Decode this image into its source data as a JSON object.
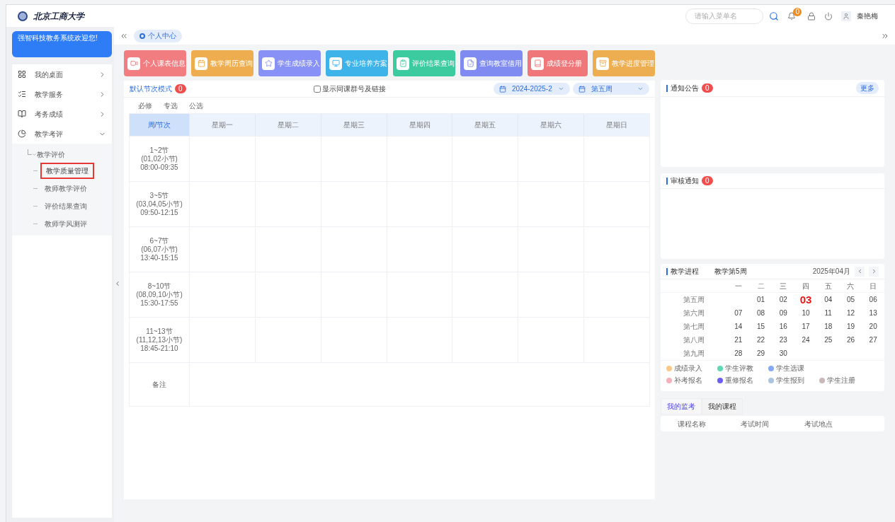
{
  "header": {
    "logo_text": "北京工商大学",
    "search": {
      "placeholder": "请输入菜单名"
    },
    "notification_count": "0",
    "user_name": "秦艳梅"
  },
  "sidebar": {
    "welcome": "强智科技教务系统欢迎您!",
    "items": [
      {
        "label": "我的桌面",
        "expanded": false,
        "kind": "desktop"
      },
      {
        "label": "教学服务",
        "expanded": false,
        "kind": "service"
      },
      {
        "label": "考务成绩",
        "expanded": false,
        "kind": "exam"
      },
      {
        "label": "教学考评",
        "expanded": true,
        "kind": "eval",
        "children": [
          {
            "label": "教学评价",
            "expanded": true,
            "children": [
              {
                "label": "教学质量管理",
                "selected": true
              },
              {
                "label": "教师教学评价",
                "selected": false
              },
              {
                "label": "评价结果查询",
                "selected": false
              },
              {
                "label": "教师学风测评",
                "selected": false
              }
            ]
          }
        ]
      }
    ]
  },
  "tabs": [
    {
      "label": "个人中心",
      "selected": true
    }
  ],
  "quick_links": [
    {
      "label": "个人课表信息",
      "color": "#f17d80",
      "kind": "video"
    },
    {
      "label": "教学周历查询",
      "color": "#eeae4f",
      "kind": "calendar"
    },
    {
      "label": "学生成绩录入",
      "color": "#8892f6",
      "kind": "star"
    },
    {
      "label": "专业培养方案",
      "color": "#3db3ea",
      "kind": "monitor"
    },
    {
      "label": "评价结果查询",
      "color": "#3ccb9f",
      "kind": "clipboard"
    },
    {
      "label": "查询教室借用",
      "color": "#7f8bf1",
      "kind": "file"
    },
    {
      "label": "成绩登分册",
      "color": "#f07779",
      "kind": "book"
    },
    {
      "label": "教学进度管理",
      "color": "#edae52",
      "kind": "archive"
    }
  ],
  "schedule": {
    "mode_label": "默认节次模式",
    "mode_badge": "0",
    "checkbox": {
      "label": "显示同课群号及链接",
      "checked": false
    },
    "term_select": "2024-2025-2",
    "week_select": "第五周",
    "legend": [
      "必修",
      "专选",
      "公选"
    ],
    "columns": [
      "周/节次",
      "星期一",
      "星期二",
      "星期三",
      "星期四",
      "星期五",
      "星期六",
      "星期日"
    ],
    "rows": [
      [
        "1~2节",
        "(01,02小节)",
        "08:00-09:35"
      ],
      [
        "3~5节",
        "(03,04,05小节)",
        "09:50-12:15"
      ],
      [
        "6~7节",
        "(06,07小节)",
        "13:40-15:15"
      ],
      [
        "8~10节",
        "(08,09,10小节)",
        "15:30-17:55"
      ],
      [
        "11~13节",
        "(11,12,13小节)",
        "18:45-21:10"
      ]
    ],
    "note_label": "备注"
  },
  "notices": {
    "title": "通知公告",
    "badge": "0",
    "more": "更多"
  },
  "audit": {
    "title": "审核通知",
    "badge": "0"
  },
  "calendar": {
    "title": "教学进程",
    "week_label": "教学第5周",
    "month": "2025年04月",
    "weekdays": [
      "一",
      "二",
      "三",
      "四",
      "五",
      "六",
      "日"
    ],
    "weeks": [
      {
        "label": "第五周",
        "days": [
          {
            "d": "01",
            "today": false
          },
          {
            "d": "02",
            "today": false
          },
          {
            "d": "03",
            "today": true
          },
          {
            "d": "04",
            "today": false
          },
          {
            "d": "05",
            "today": false
          },
          {
            "d": "06",
            "today": false
          }
        ]
      },
      {
        "label": "第六周",
        "days": [
          {
            "d": "07",
            "today": false
          },
          {
            "d": "08",
            "today": false
          },
          {
            "d": "09",
            "today": false
          },
          {
            "d": "10",
            "today": false
          },
          {
            "d": "11",
            "today": false
          },
          {
            "d": "12",
            "today": false
          },
          {
            "d": "13",
            "today": false
          }
        ]
      },
      {
        "label": "第七周",
        "days": [
          {
            "d": "14",
            "today": false
          },
          {
            "d": "15",
            "today": false
          },
          {
            "d": "16",
            "today": false
          },
          {
            "d": "17",
            "today": false
          },
          {
            "d": "18",
            "today": false
          },
          {
            "d": "19",
            "today": false
          },
          {
            "d": "20",
            "today": false
          }
        ]
      },
      {
        "label": "第八周",
        "days": [
          {
            "d": "21",
            "today": false
          },
          {
            "d": "22",
            "today": false
          },
          {
            "d": "23",
            "today": false
          },
          {
            "d": "24",
            "today": false
          },
          {
            "d": "25",
            "today": false
          },
          {
            "d": "26",
            "today": false
          },
          {
            "d": "27",
            "today": false
          }
        ]
      },
      {
        "label": "第九周",
        "days": [
          {
            "d": "28",
            "today": false
          },
          {
            "d": "29",
            "today": false
          },
          {
            "d": "30",
            "today": false
          }
        ]
      }
    ],
    "legend": [
      [
        {
          "label": "成绩录入",
          "color": "#fcc98a"
        },
        {
          "label": "学生评教",
          "color": "#5fd9b4"
        },
        {
          "label": "学生选课",
          "color": "#86a9f5"
        }
      ],
      [
        {
          "label": "补考报名",
          "color": "#f5b1b9"
        },
        {
          "label": "重修报名",
          "color": "#6a5ff0"
        },
        {
          "label": "学生报到",
          "color": "#a9c4e2"
        },
        {
          "label": "学生注册",
          "color": "#c9b8b8"
        }
      ]
    ]
  },
  "bottom_tabs": [
    {
      "label": "我的监考",
      "selected": true
    },
    {
      "label": "我的课程",
      "selected": false
    }
  ],
  "exam_table": {
    "columns": [
      "课程名称",
      "考试时间",
      "考试地点"
    ]
  }
}
